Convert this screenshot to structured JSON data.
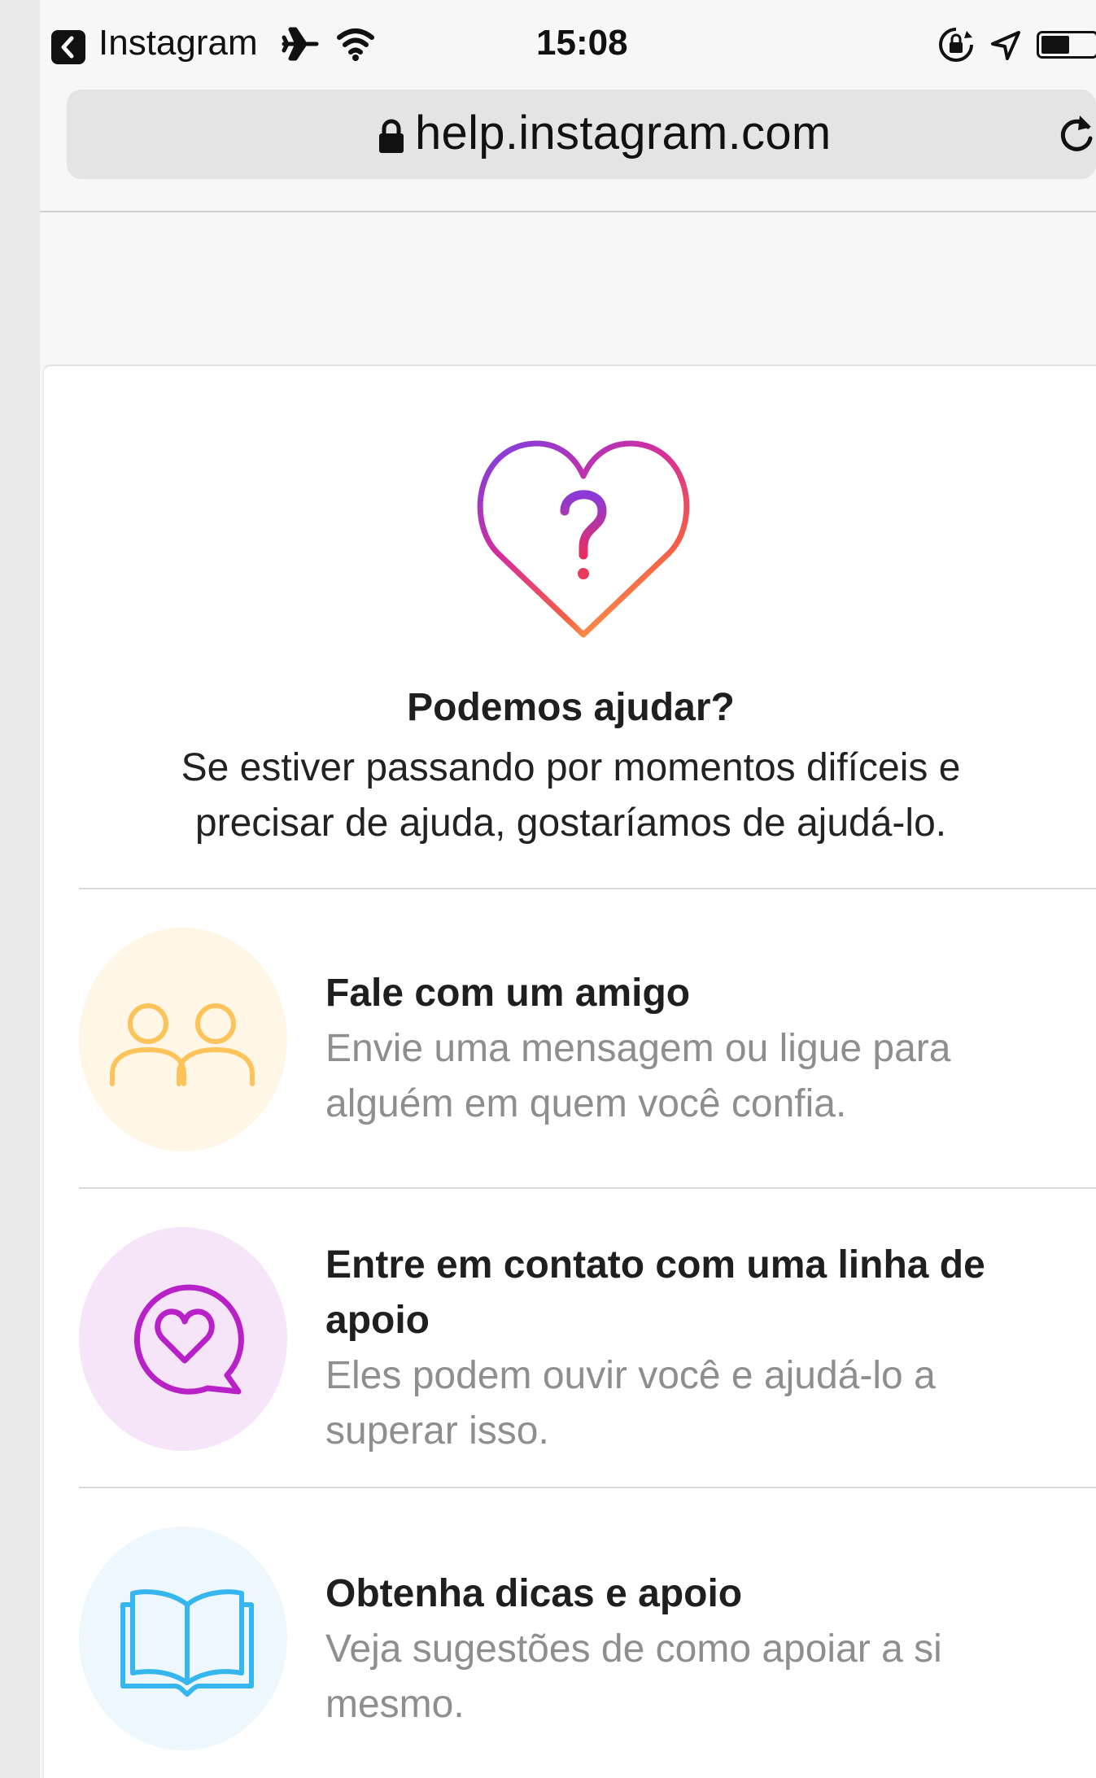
{
  "status_bar": {
    "back_app": "Instagram",
    "time": "15:08"
  },
  "browser": {
    "url": "help.instagram.com"
  },
  "hero": {
    "title": "Podemos ajudar?",
    "body_line1": "Se estiver passando por momentos difíceis e",
    "body_line2": "precisar de ajuda, gostaríamos de ajudá-lo."
  },
  "options": [
    {
      "title": "Fale com um amigo",
      "desc_line1": "Envie uma mensagem ou ligue para",
      "desc_line2": "alguém em quem você confia.",
      "icon": "friends-icon",
      "color": "#fcc35a",
      "bg": "#fff6e6"
    },
    {
      "title_line1": "Entre em contato com uma linha de",
      "title_line2": "apoio",
      "desc_line1": "Eles podem ouvir você e ajudá-lo a",
      "desc_line2": "superar isso.",
      "icon": "heart-chat-icon",
      "color": "#b820c8",
      "bg": "#f6e5f8"
    },
    {
      "title": "Obtenha dicas e apoio",
      "desc_line1": "Veja sugestões de como apoiar a si",
      "desc_line2": "mesmo.",
      "icon": "book-icon",
      "color": "#35b6ee",
      "bg": "#eef7fd"
    }
  ]
}
